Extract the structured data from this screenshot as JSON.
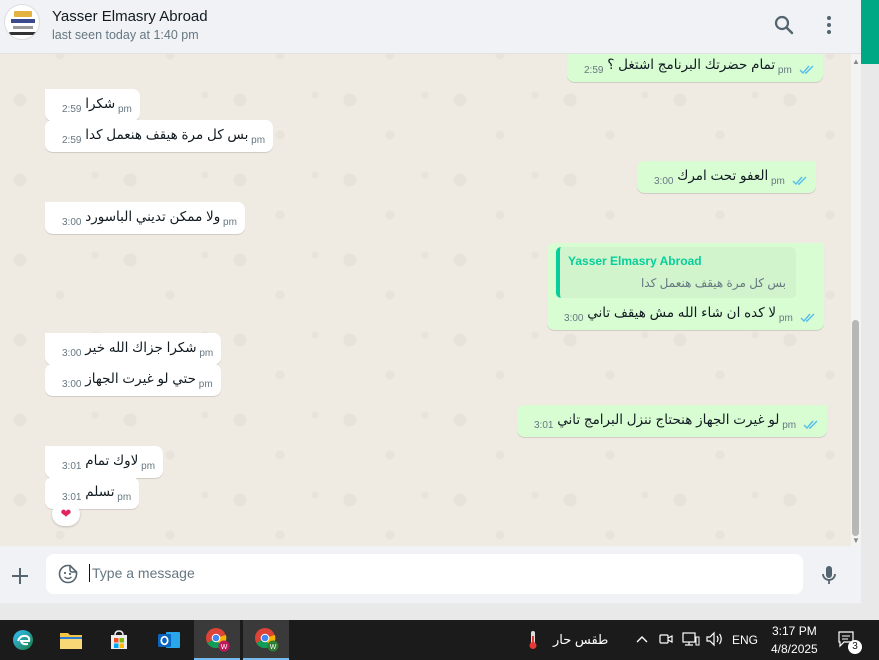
{
  "header": {
    "contact_name": "Yasser Elmasry Abroad",
    "last_seen": "last seen today at 1:40 pm"
  },
  "messages": [
    {
      "text": "تمام حضرتك البرنامج اشتغل ؟",
      "time": "2:59 pm"
    },
    {
      "text": "شكرا",
      "time": "2:59 pm"
    },
    {
      "text": "بس كل مرة هيقف هنعمل كدا",
      "time": "2:59 pm"
    },
    {
      "text": "العفو تحت امرك",
      "time": "3:00 pm"
    },
    {
      "text": "ولا ممكن تديني الباسورد",
      "time": "3:00 pm"
    },
    {
      "quote_name": "Yasser Elmasry Abroad",
      "quote_text": "بس كل مرة هيقف هنعمل كدا",
      "text": "لا كده ان شاء الله مش هيقف تاني",
      "time": "3:00 pm"
    },
    {
      "text": "شكرا جزاك الله خير",
      "time": "3:00 pm"
    },
    {
      "text": "حتي لو غيرت الجهاز",
      "time": "3:00 pm"
    },
    {
      "text": "لو غيرت الجهاز هنحتاج ننزل البرامج تاني",
      "time": "3:01 pm"
    },
    {
      "text": "لاوك تمام",
      "time": "3:01 pm"
    },
    {
      "text": "تسلم",
      "time": "3:01 pm"
    }
  ],
  "reaction": "❤",
  "composer": {
    "placeholder": "Type a message"
  },
  "taskbar": {
    "weather": "طقس حار",
    "language": "ENG",
    "time": "3:17 PM",
    "date": "4/8/2025",
    "notifications": "3",
    "badge_w": "W"
  },
  "colors": {
    "incoming": "#ffffff",
    "outgoing": "#d9fdd3",
    "accent": "#00a884",
    "ticks": "#53bdeb"
  }
}
